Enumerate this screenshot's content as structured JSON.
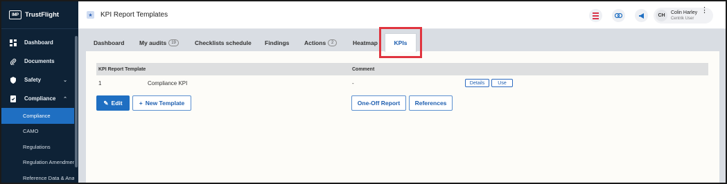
{
  "app": {
    "brand_logo": "IMP",
    "brand_name": "TrustFlight"
  },
  "sidebar": {
    "items": [
      {
        "label": "Dashboard",
        "icon": "dashboard-icon"
      },
      {
        "label": "Documents",
        "icon": "paperclip-icon"
      },
      {
        "label": "Safety",
        "icon": "shield-icon",
        "expandable": true
      },
      {
        "label": "Compliance",
        "icon": "compliance-icon",
        "expanded": true
      }
    ],
    "subitems": [
      {
        "label": "Compliance",
        "active": true
      },
      {
        "label": "CAMO"
      },
      {
        "label": "Regulations"
      },
      {
        "label": "Regulation Amendments"
      },
      {
        "label": "Reference Data & Ana..."
      }
    ]
  },
  "header": {
    "title": "KPI Report Templates",
    "user": {
      "initials": "CH",
      "name": "Colin Harley",
      "role": "Centrik User"
    }
  },
  "tabs": [
    {
      "label": "Dashboard"
    },
    {
      "label": "My audits",
      "badge": "19"
    },
    {
      "label": "Checklists schedule"
    },
    {
      "label": "Findings"
    },
    {
      "label": "Actions",
      "badge": "2"
    },
    {
      "label": "Heatmap"
    },
    {
      "label": "KPIs",
      "active": true
    }
  ],
  "table": {
    "columns": [
      "KPI Report Template",
      "Comment"
    ],
    "rows": [
      {
        "id": "1",
        "name": "Compliance KPI",
        "comment": "-",
        "actions": [
          "Details",
          "Use"
        ]
      }
    ]
  },
  "buttons": {
    "edit": "Edit",
    "new_template": "New Template",
    "one_off_report": "One-Off Report",
    "references": "References"
  },
  "colors": {
    "accent": "#1f6fc2",
    "sidebar": "#0e2236",
    "highlight": "#e0343e"
  }
}
